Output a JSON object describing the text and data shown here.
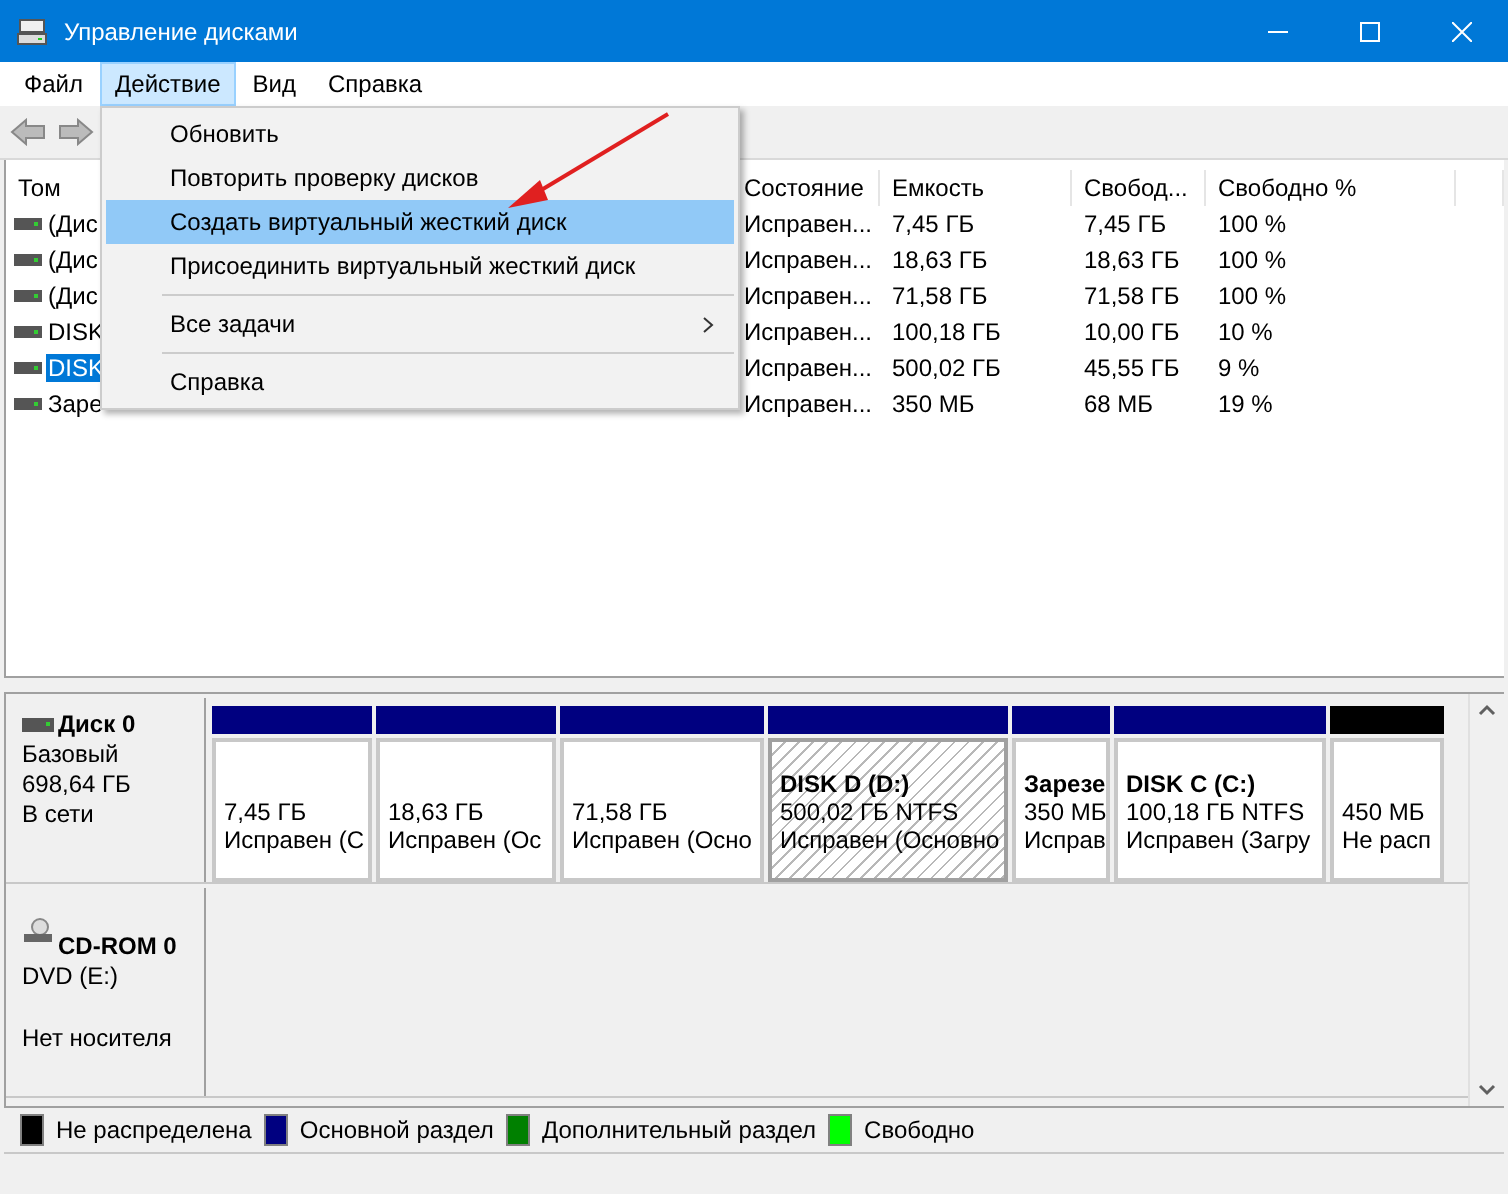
{
  "window": {
    "title": "Управление дисками"
  },
  "menu_bar": [
    {
      "label": "Файл",
      "selected": false
    },
    {
      "label": "Действие",
      "selected": true
    },
    {
      "label": "Вид",
      "selected": false
    },
    {
      "label": "Справка",
      "selected": false
    }
  ],
  "dropdown": {
    "items": [
      {
        "label": "Обновить",
        "selected": false,
        "has_submenu": false,
        "separator_after": false
      },
      {
        "label": "Повторить проверку дисков",
        "selected": false,
        "has_submenu": false,
        "separator_after": false
      },
      {
        "label": "Создать виртуальный жесткий диск",
        "selected": true,
        "has_submenu": false,
        "separator_after": false
      },
      {
        "label": "Присоединить виртуальный жесткий диск",
        "selected": false,
        "has_submenu": false,
        "separator_after": true
      },
      {
        "label": "Все задачи",
        "selected": false,
        "has_submenu": true,
        "separator_after": true
      },
      {
        "label": "Справка",
        "selected": false,
        "has_submenu": false,
        "separator_after": false
      }
    ]
  },
  "table": {
    "columns": [
      "Том",
      "Состояние",
      "Емкость",
      "Свобод...",
      "Свободно %"
    ],
    "rows": [
      {
        "cells": [
          "(Дис",
          "Исправен...",
          "7,45 ГБ",
          "7,45 ГБ",
          "100 %"
        ],
        "selected": false
      },
      {
        "cells": [
          "(Дис",
          "Исправен...",
          "18,63 ГБ",
          "18,63 ГБ",
          "100 %"
        ],
        "selected": false
      },
      {
        "cells": [
          "(Дис",
          "Исправен...",
          "71,58 ГБ",
          "71,58 ГБ",
          "100 %"
        ],
        "selected": false
      },
      {
        "cells": [
          "DISK",
          "Исправен...",
          "100,18 ГБ",
          "10,00 ГБ",
          "10 %"
        ],
        "selected": false
      },
      {
        "cells": [
          "DISK",
          "Исправен...",
          "500,02 ГБ",
          "45,55 ГБ",
          "9 %"
        ],
        "selected": true
      },
      {
        "cells": [
          "Заре",
          "Исправен...",
          "350 МБ",
          "68 МБ",
          "19 %"
        ],
        "selected": false
      }
    ]
  },
  "disks": [
    {
      "kind": "disk",
      "name": "Диск 0",
      "lines": [
        "Базовый",
        "698,64 ГБ",
        "В сети"
      ],
      "partitions": [
        {
          "color": "#000080",
          "selected": false,
          "lines": [
            "7,45 ГБ",
            "Исправен (С"
          ]
        },
        {
          "color": "#000080",
          "selected": false,
          "lines": [
            "18,63 ГБ",
            "Исправен (Ос"
          ]
        },
        {
          "color": "#000080",
          "selected": false,
          "lines": [
            "71,58 ГБ",
            "Исправен (Осно"
          ]
        },
        {
          "color": "#000080",
          "selected": true,
          "label": "DISK D  (D:)",
          "lines": [
            "500,02 ГБ NTFS",
            "Исправен (Основно"
          ]
        },
        {
          "color": "#000080",
          "selected": false,
          "label": "Зарезе",
          "lines": [
            "350 МБ",
            "Исправ"
          ]
        },
        {
          "color": "#000080",
          "selected": false,
          "label": "DISK C  (C:)",
          "lines": [
            "100,18 ГБ NTFS",
            "Исправен (Загру"
          ]
        },
        {
          "color": "#000000",
          "selected": false,
          "lines": [
            "450 МБ",
            "Не расп"
          ]
        }
      ]
    },
    {
      "kind": "cdrom",
      "name": "CD-ROM 0",
      "lines": [
        "DVD (E:)",
        "Нет носителя"
      ]
    }
  ],
  "legend": [
    {
      "label": "Не распределена",
      "color": "#000000"
    },
    {
      "label": "Основной раздел",
      "color": "#000080"
    },
    {
      "label": "Дополнительный раздел",
      "color": "#008000"
    },
    {
      "label": "Свободно",
      "color": "#00ff00"
    }
  ]
}
